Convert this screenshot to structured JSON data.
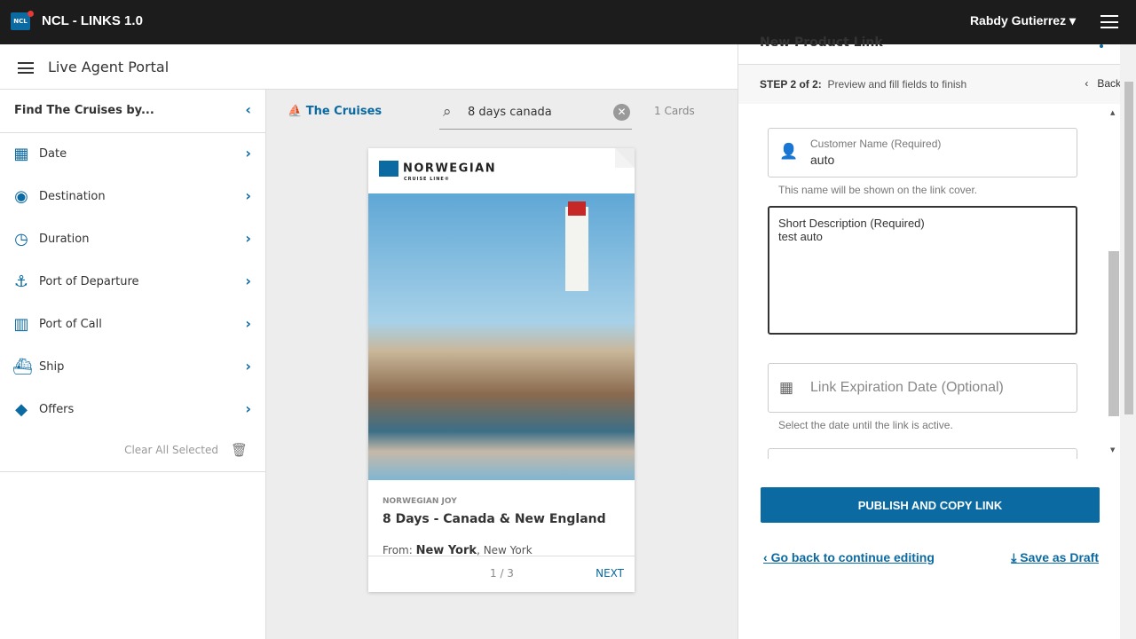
{
  "app": {
    "logo": "NCL",
    "title": "NCL - LINKS 1.0",
    "user": "Rabdy Gutierrez ▾"
  },
  "subbar": {
    "title": "Live Agent Portal"
  },
  "sidebar": {
    "heading": "Find The Cruises by...",
    "items": [
      {
        "label": "Date",
        "icon": "calendar-icon"
      },
      {
        "label": "Destination",
        "icon": "globe-icon"
      },
      {
        "label": "Duration",
        "icon": "clock-icon"
      },
      {
        "label": "Port of Departure",
        "icon": "anchor-icon"
      },
      {
        "label": "Port of Call",
        "icon": "map-icon"
      },
      {
        "label": "Ship",
        "icon": "ship-icon"
      },
      {
        "label": "Offers",
        "icon": "tag-icon"
      }
    ],
    "clear": "Clear All Selected"
  },
  "main": {
    "section": "The Cruises",
    "search_value": "8 days canada",
    "count": "1 Cards"
  },
  "card": {
    "brand": "NORWEGIAN",
    "brand_sub": "CRUISE LINE®",
    "ship": "NORWEGIAN JOY",
    "title": "8 Days - Canada & New England",
    "from_label": "From:",
    "from_city": "New York",
    "from_state": ", New York",
    "page": "1 / 3",
    "next": "NEXT"
  },
  "panel": {
    "title": "New Product Link",
    "step": "STEP 2 of 2:",
    "step_desc": "Preview and fill fields to finish",
    "back": "Back",
    "customer_label": "Customer Name (Required)",
    "customer_value": "auto",
    "customer_hint": "This name will be shown on the link cover.",
    "desc_label": "Short Description (Required)",
    "desc_value": "test auto",
    "expiry_placeholder": "Link Expiration Date (Optional)",
    "expiry_hint": "Select the date until the link is active.",
    "publish": "PUBLISH AND COPY LINK",
    "go_back": "Go back to continue editing",
    "save_draft": "Save as Draft"
  }
}
